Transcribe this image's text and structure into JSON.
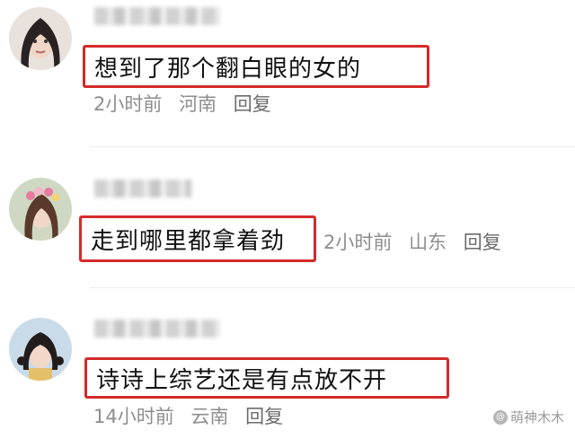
{
  "comments": [
    {
      "content": "想到了那个翻白眼的女的",
      "time": "2小时前",
      "location": "河南",
      "reply_label": "回复"
    },
    {
      "content": "走到哪里都拿着劲",
      "time": "2小时前",
      "location": "山东",
      "reply_label": "回复"
    },
    {
      "content": "诗诗上综艺还是有点放不开",
      "time": "14小时前",
      "location": "云南",
      "reply_label": "回复"
    }
  ],
  "watermark": {
    "text": "萌神木木",
    "icon": "at-icon"
  }
}
